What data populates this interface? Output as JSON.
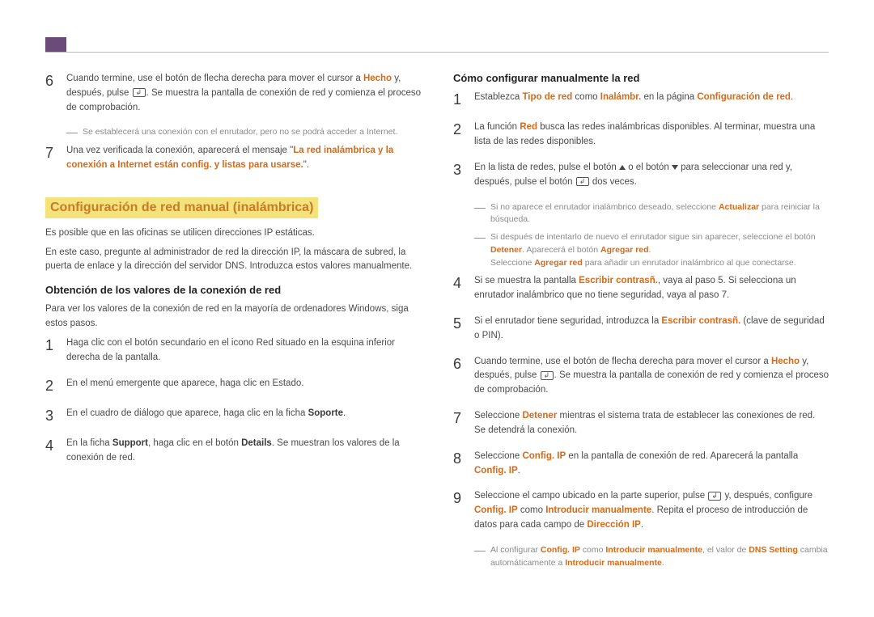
{
  "left": {
    "step6a": "Cuando termine, use el botón de flecha derecha para mover el cursor a ",
    "step6b": " y, después, pulse ",
    "step6c": ". Se muestra la pantalla de conexión de red y comienza el proceso de comprobación.",
    "hecho": "Hecho",
    "noteA": "Se establecerá una conexión con el enrutador, pero no se podrá acceder a Internet.",
    "step7a": "Una vez verificada la conexión, aparecerá el mensaje \"",
    "step7b": "La red inalámbrica y la conexión a Internet están config. y listas para usarse.",
    "step7c": "\".",
    "h2": "Configuración de red manual (inalámbrica)",
    "p1": "Es posible que en las oficinas se utilicen direcciones IP estáticas.",
    "p2": "En este caso, pregunte al administrador de red la dirección IP, la máscara de subred, la puerta de enlace y la dirección del servidor DNS. Introduzca estos valores manualmente.",
    "h3": "Obtención de los valores de la conexión de red",
    "p3": "Para ver los valores de la conexión de red en la mayoría de ordenadores Windows, siga estos pasos.",
    "s1": "Haga clic con el botón secundario en el icono Red situado en la esquina inferior derecha de la pantalla.",
    "s2": "En el menú emergente que aparece, haga clic en Estado.",
    "s3a": "En el cuadro de diálogo que aparece, haga clic en la ficha ",
    "soporte": "Soporte",
    "s4a": "En la ficha ",
    "support": "Support",
    "s4b": ", haga clic en el botón ",
    "details": "Details",
    "s4c": ". Se muestran los valores de la conexión de red."
  },
  "right": {
    "h3": "Cómo configurar manualmente la red",
    "s1a": "Establezca ",
    "tipo": "Tipo de red",
    "s1b": " como ",
    "inalambr": "Inalámbr.",
    "s1c": " en la página ",
    "confred": "Configuración de red",
    "s2a": "La función ",
    "red": "Red",
    "s2b": " busca las redes inalámbricas disponibles. Al terminar, muestra una lista de las redes disponibles.",
    "s3a": "En la lista de redes, pulse el botón ",
    "s3b": " o el botón ",
    "s3c": " para seleccionar una red y, después, pulse el botón ",
    "s3d": " dos veces.",
    "n1a": "Si no aparece el enrutador inalámbrico deseado, seleccione ",
    "actualizar": "Actualizar",
    "n1b": " para reiniciar la búsqueda.",
    "n2a": "Si después de intentarlo de nuevo el enrutador sigue sin aparecer, seleccione el botón ",
    "detener": "Detener",
    "n2b": ". Aparecerá el botón ",
    "agregar": "Agregar red",
    "n3a": "Seleccione ",
    "n3b": " para añadir un enrutador inalámbrico al que conectarse.",
    "s4a": "Si se muestra la pantalla ",
    "escribir": "Escribir contrasñ.",
    "s4b": ", vaya al paso 5. Si selecciona un enrutador inalámbrico que no tiene seguridad, vaya al paso 7.",
    "s5a": "Si el enrutador tiene seguridad, introduzca la ",
    "s5b": " (clave de seguridad o PIN).",
    "s6a": "Cuando termine, use el botón de flecha derecha para mover el cursor a ",
    "s6b": " y, después, pulse ",
    "s6c": ". Se muestra la pantalla de conexión de red y comienza el proceso de comprobación.",
    "s7a": "Seleccione ",
    "s7b": " mientras el sistema trata de establecer las conexiones de red. Se detendrá la conexión.",
    "s8a": "Seleccione ",
    "configip": "Config. IP",
    "s8b": " en la pantalla de conexión de red. Aparecerá la pantalla ",
    "s9a": "Seleccione el campo ubicado en la parte superior, pulse ",
    "s9b": " y, después, configure ",
    "s9c": " como ",
    "introman": "Introducir manualmente",
    "s9d": ". Repita el proceso de introducción de datos para cada campo de ",
    "dirip": "Dirección IP",
    "nfa": "Al configurar ",
    "nfb": " como ",
    "nfc": ", el valor de ",
    "dnssetting": "DNS Setting",
    "nfd": " cambia automáticamente a "
  }
}
